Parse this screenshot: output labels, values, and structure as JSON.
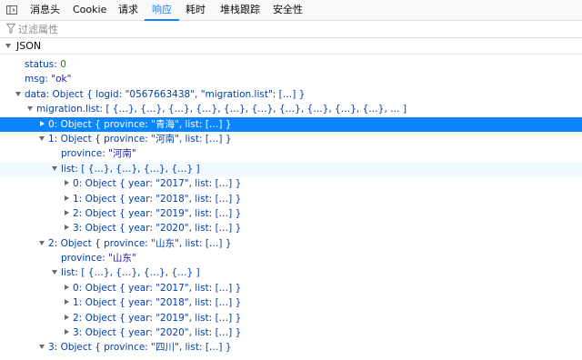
{
  "toolbar": {
    "tabs": [
      {
        "label": "消息头",
        "active": false
      },
      {
        "label": "Cookie",
        "active": false
      },
      {
        "label": "请求",
        "active": false
      },
      {
        "label": "响应",
        "active": true
      },
      {
        "label": "耗时",
        "active": false
      },
      {
        "label": "堆栈跟踪",
        "active": false
      },
      {
        "label": "安全性",
        "active": false
      }
    ],
    "left_icon": "panel-toggle-icon"
  },
  "filter": {
    "icon": "filter-icon",
    "placeholder": "过滤属性",
    "value": ""
  },
  "section": {
    "title": "JSON",
    "expanded": true
  },
  "tree": {
    "rows": [
      {
        "key": "status:",
        "val": "0",
        "valType": "number"
      },
      {
        "key": "msg:",
        "val": "\"ok\"",
        "valType": "string"
      },
      {
        "key": "data:",
        "val": "Object { logid: \"0567663438\", \"migration.list\": […] }",
        "valType": "preview"
      },
      {
        "key": "migration.list:",
        "val": "[ {…}, {…}, {…}, {…}, {…}, {…}, {…}, {…}, {…}, {…}, … ]",
        "valType": "preview"
      },
      {
        "key": "0:",
        "val": "Object { province: \"青海\", list: […] }",
        "valType": "preview",
        "selected": true
      },
      {
        "key": "1:",
        "val": "Object { province: \"河南\", list: […] }",
        "valType": "preview"
      },
      {
        "key": "province:",
        "val": "\"河南\"",
        "valType": "string"
      },
      {
        "key": "list:",
        "val": "[ {…}, {…}, {…}, {…} ]",
        "valType": "preview",
        "hover": true
      },
      {
        "key": "0:",
        "val": "Object { year: \"2017\", list: […] }",
        "valType": "preview"
      },
      {
        "key": "1:",
        "val": "Object { year: \"2018\", list: […] }",
        "valType": "preview"
      },
      {
        "key": "2:",
        "val": "Object { year: \"2019\", list: […] }",
        "valType": "preview"
      },
      {
        "key": "3:",
        "val": "Object { year: \"2020\", list: […] }",
        "valType": "preview"
      },
      {
        "key": "2:",
        "val": "Object { province: \"山东\", list: […] }",
        "valType": "preview"
      },
      {
        "key": "province:",
        "val": "\"山东\"",
        "valType": "string"
      },
      {
        "key": "list:",
        "val": "[ {…}, {…}, {…}, {…} ]",
        "valType": "preview"
      },
      {
        "key": "0:",
        "val": "Object { year: \"2017\", list: […] }",
        "valType": "preview"
      },
      {
        "key": "1:",
        "val": "Object { year: \"2018\", list: […] }",
        "valType": "preview"
      },
      {
        "key": "2:",
        "val": "Object { year: \"2019\", list: […] }",
        "valType": "preview"
      },
      {
        "key": "3:",
        "val": "Object { year: \"2020\", list: […] }",
        "valType": "preview"
      },
      {
        "key": "3:",
        "val": "Object { province: \"四川\", list: […] }",
        "valType": "preview"
      }
    ]
  }
}
